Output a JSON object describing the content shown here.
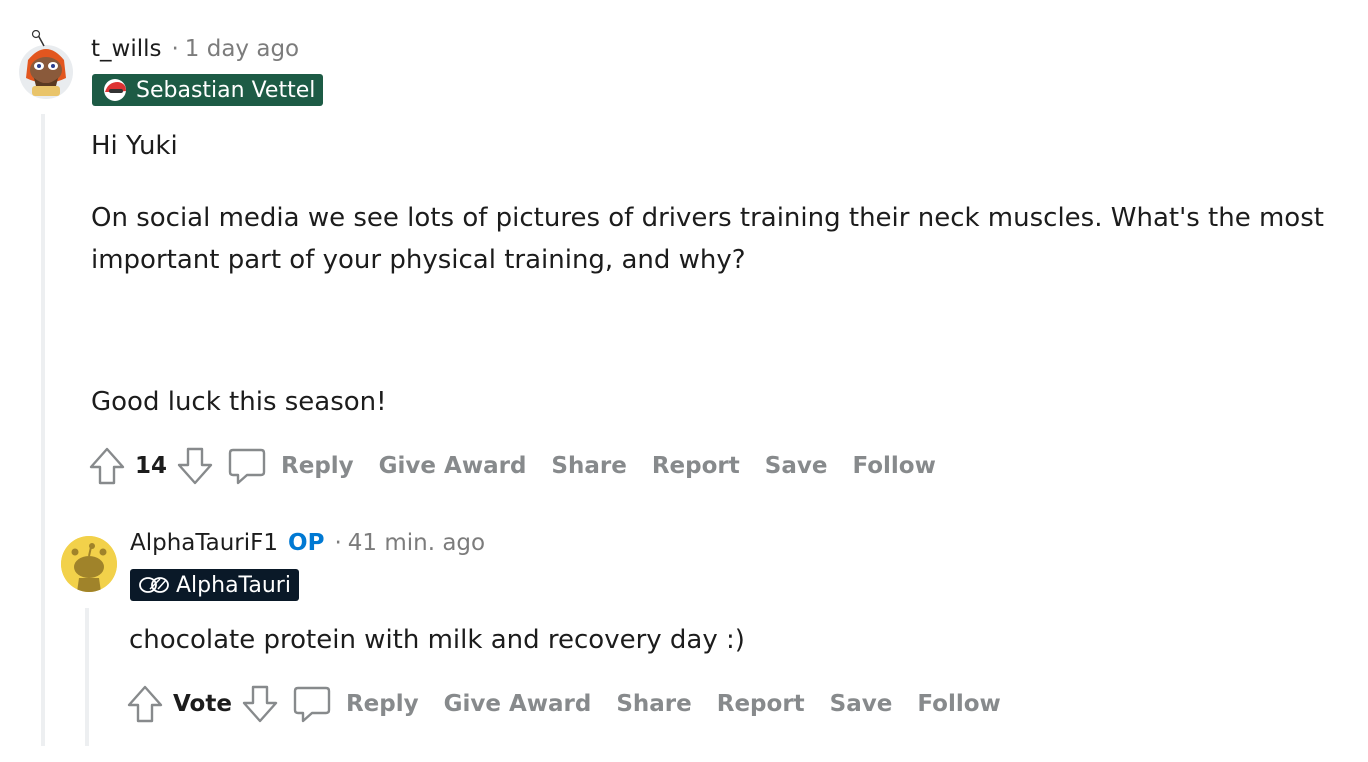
{
  "comment1": {
    "username": "t_wills",
    "separator": "·",
    "time": "1 day ago",
    "flair": "Sebastian Vettel",
    "paragraphs": [
      "Hi Yuki",
      "On social media we see lots of pictures of drivers training their neck muscles. What's the most important part of your physical training, and why?",
      "Good luck this season!"
    ],
    "score": "14",
    "actions": {
      "reply": "Reply",
      "give_award": "Give Award",
      "share": "Share",
      "report": "Report",
      "save": "Save",
      "follow": "Follow"
    }
  },
  "comment2": {
    "username": "AlphaTauriF1",
    "op_badge": "OP",
    "separator": "·",
    "time": "41 min. ago",
    "flair": "AlphaTauri",
    "paragraphs": [
      "chocolate protein with milk and recovery day :)"
    ],
    "score": "Vote",
    "actions": {
      "reply": "Reply",
      "give_award": "Give Award",
      "share": "Share",
      "report": "Report",
      "save": "Save",
      "follow": "Follow"
    }
  },
  "colors": {
    "flair1_bg": "#1d5b45",
    "flair2_bg": "#0a1928",
    "op_blue": "#0079d3",
    "action_gray": "#878a8c",
    "thread_line": "#edeff1"
  },
  "icons": {
    "upvote": "arrow-up-icon",
    "downvote": "arrow-down-icon",
    "comment": "comment-bubble-icon",
    "helmet": "helmet-icon",
    "team_logo": "alphatauri-logo-icon"
  }
}
